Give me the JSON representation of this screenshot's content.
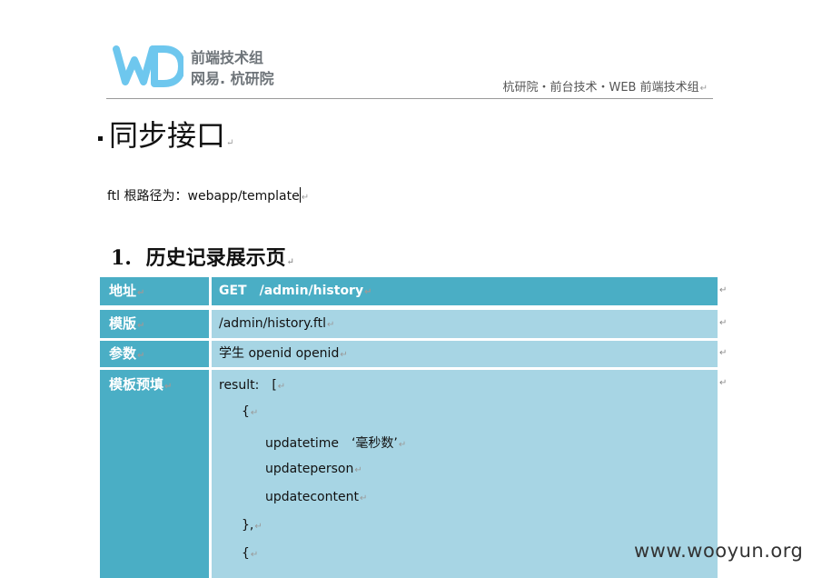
{
  "header": {
    "brand_line1": "前端技术组",
    "brand_line2": "网易. 杭研院",
    "path": "杭研院・前台技术・WEB 前端技术组"
  },
  "section": {
    "title": "同步接口"
  },
  "ftl_root": "ftl 根路径为：webapp/template",
  "subsection": {
    "number": "1.",
    "title": "历史记录展示页"
  },
  "table": {
    "rows": [
      {
        "label": "地址",
        "value": "GET　/admin/history"
      },
      {
        "label": "模版",
        "value": "/admin/history.ftl"
      },
      {
        "label": "参数",
        "value": "学生 openid openid"
      },
      {
        "label": "模板预填",
        "value": "result:　["
      }
    ],
    "code_lines": [
      "{",
      "updatetime　‘毫秒数’",
      "updateperson",
      "updatecontent",
      "},",
      "{"
    ]
  },
  "mark": "↵",
  "watermark": "www.wooyun.org"
}
